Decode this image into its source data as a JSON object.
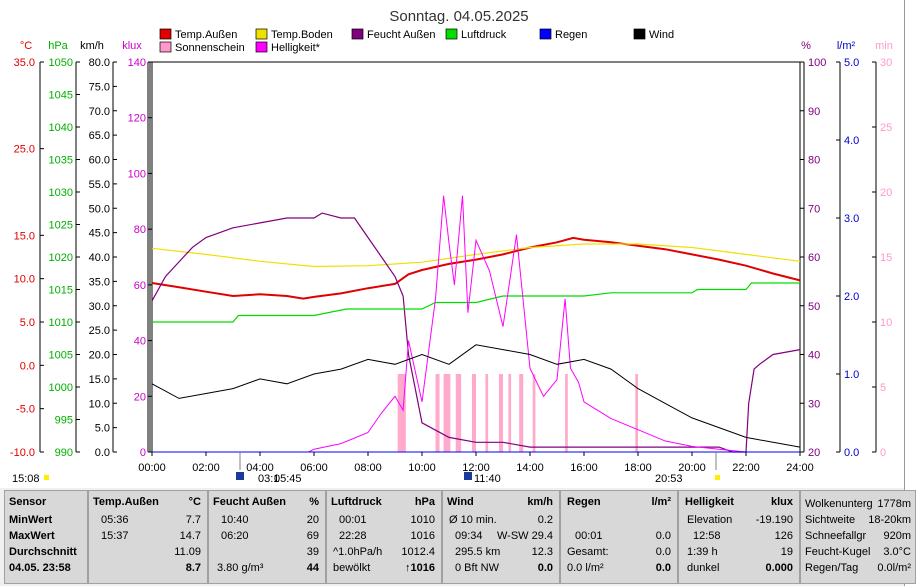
{
  "chart_data": {
    "type": "line",
    "title": "Sonntag. 04.05.2025",
    "x_ticks": [
      "00:00",
      "02:00",
      "04:00",
      "06:00",
      "08:00",
      "10:00",
      "12:00",
      "14:00",
      "16:00",
      "18:00",
      "20:00",
      "22:00",
      "24:00"
    ],
    "xlim": [
      0,
      24
    ],
    "axes": {
      "temp": {
        "unit": "°C",
        "range": [
          -10,
          35
        ],
        "ticks": [
          "35.0",
          "25.0",
          "15.0",
          "10.0",
          "5.0",
          "0.0",
          "-5.0",
          "-10.0"
        ],
        "color": "#e00000"
      },
      "pressure": {
        "unit": "hPa",
        "range": [
          990,
          1050
        ],
        "ticks": [
          "1050",
          "1045",
          "1040",
          "1035",
          "1030",
          "1025",
          "1020",
          "1015",
          "1010",
          "1005",
          "1000",
          "995",
          "990"
        ],
        "color": "#00b000"
      },
      "wind": {
        "unit": "km/h",
        "range": [
          0,
          80
        ],
        "ticks": [
          "80.0",
          "75.0",
          "70.0",
          "65.0",
          "60.0",
          "55.0",
          "50.0",
          "45.0",
          "40.0",
          "35.0",
          "30.0",
          "25.0",
          "20.0",
          "15.0",
          "10.0",
          "5.0",
          "0.0"
        ],
        "color": "#000000"
      },
      "light": {
        "unit": "klux",
        "range": [
          0,
          140
        ],
        "ticks": [
          "140",
          "120",
          "100",
          "80",
          "60",
          "40",
          "20",
          "0"
        ],
        "color": "#cc00cc"
      },
      "humidity": {
        "unit": "%",
        "range": [
          20,
          100
        ],
        "ticks": [
          "100",
          "90",
          "80",
          "70",
          "60",
          "50",
          "40",
          "30",
          "20"
        ],
        "color": "#800080"
      },
      "rain": {
        "unit": "l/m²",
        "range": [
          0,
          5
        ],
        "ticks": [
          "5.0",
          "4.0",
          "3.0",
          "2.0",
          "1.0",
          "0.0"
        ],
        "color": "#0000cc"
      },
      "sunshine": {
        "unit": "min",
        "range": [
          0,
          30
        ],
        "ticks": [
          "30",
          "25",
          "20",
          "15",
          "10",
          "5",
          "0"
        ],
        "color": "#ff99cc"
      }
    },
    "legend": [
      {
        "label": "Temp.Außen",
        "color": "#e00000"
      },
      {
        "label": "Temp.Boden",
        "color": "#f0e000"
      },
      {
        "label": "Feucht Außen",
        "color": "#800080"
      },
      {
        "label": "Luftdruck",
        "color": "#00dd00"
      },
      {
        "label": "Regen",
        "color": "#0000ff"
      },
      {
        "label": "Wind",
        "color": "#000000"
      },
      {
        "label": "Sonnenschein",
        "color": "#ff99cc"
      },
      {
        "label": "Helligkeit*",
        "color": "#ff00ff"
      }
    ],
    "series": [
      {
        "name": "Temp.Außen",
        "axis": "temp",
        "x": [
          0,
          1,
          2,
          3,
          4,
          5,
          5.6,
          6,
          7,
          8,
          9,
          9.5,
          10,
          11,
          12,
          13,
          14,
          15,
          15.6,
          16,
          17,
          18,
          19,
          20,
          21,
          22,
          23,
          24
        ],
        "y": [
          9.5,
          9.0,
          8.5,
          8.0,
          8.2,
          8.0,
          7.7,
          7.9,
          8.3,
          8.9,
          9.4,
          10.5,
          11.0,
          11.7,
          12.2,
          12.8,
          13.6,
          14.2,
          14.7,
          14.5,
          14.2,
          13.8,
          13.4,
          12.8,
          12.2,
          11.5,
          10.6,
          9.8
        ]
      },
      {
        "name": "Temp.Boden",
        "axis": "temp",
        "x": [
          0,
          2,
          4,
          6,
          8,
          10,
          12,
          14,
          16,
          18,
          20,
          22,
          24
        ],
        "y": [
          13.5,
          12.8,
          12.0,
          11.4,
          11.5,
          11.9,
          12.8,
          13.6,
          14.0,
          14.0,
          13.6,
          12.8,
          12.0
        ]
      },
      {
        "name": "Feucht Außen",
        "axis": "humidity",
        "x": [
          0,
          0.5,
          1,
          1.5,
          2,
          3,
          4,
          5,
          5.6,
          6,
          6.3,
          7,
          7.5,
          8,
          8.5,
          9,
          9.3,
          9.5,
          10,
          11,
          12,
          13,
          14,
          15,
          16,
          17,
          18,
          19,
          20,
          21,
          21.5,
          22,
          22.1,
          22.3,
          22.5,
          23,
          24
        ],
        "y": [
          51,
          56,
          59,
          62,
          64,
          66,
          67,
          68,
          68,
          68,
          69,
          68,
          68,
          64,
          60,
          56,
          52,
          40,
          26,
          23,
          22,
          22,
          21,
          21,
          21,
          21,
          21,
          21,
          21,
          21,
          20,
          20,
          30,
          37,
          38,
          40,
          41
        ]
      },
      {
        "name": "Luftdruck",
        "axis": "pressure",
        "x": [
          0,
          3,
          3.2,
          6,
          7.2,
          10,
          10.5,
          12,
          13,
          16,
          17,
          20,
          20.2,
          22,
          22.2,
          24
        ],
        "y": [
          1010,
          1010,
          1011,
          1011,
          1012,
          1012,
          1013,
          1013,
          1014,
          1014,
          1014.5,
          1014.5,
          1015,
          1015,
          1016,
          1016
        ]
      },
      {
        "name": "Helligkeit*",
        "axis": "light",
        "x": [
          0,
          5,
          5.8,
          6,
          7,
          8,
          8.5,
          9,
          9.3,
          9.5,
          10,
          10.5,
          10.8,
          11,
          11.2,
          11.5,
          11.7,
          12,
          12.5,
          13,
          13.5,
          14,
          14.5,
          15,
          15.3,
          15.5,
          15.8,
          16,
          17,
          18,
          19,
          20,
          21,
          22,
          24
        ],
        "y": [
          0,
          0,
          0,
          1,
          3,
          7,
          14,
          20,
          15,
          40,
          18,
          55,
          92,
          75,
          60,
          92,
          50,
          76,
          65,
          45,
          78,
          30,
          20,
          26,
          55,
          30,
          25,
          18,
          12,
          8,
          4,
          2,
          1,
          0,
          0
        ]
      },
      {
        "name": "Wind",
        "axis": "wind",
        "x": [
          0,
          1,
          2,
          3,
          4,
          5,
          6,
          7,
          8,
          9,
          10,
          11,
          12,
          13,
          14,
          15,
          16,
          17,
          18,
          19,
          20,
          21,
          22,
          23,
          24
        ],
        "y": [
          14,
          11,
          12,
          13,
          15,
          14,
          16,
          17,
          19,
          18,
          20,
          18,
          22,
          21,
          20,
          18,
          19,
          17,
          13,
          10,
          7,
          5,
          3,
          2,
          1
        ]
      },
      {
        "name": "Regen",
        "axis": "rain",
        "x": [
          0,
          24
        ],
        "y": [
          0,
          0
        ]
      }
    ],
    "sunshine_bars": [
      {
        "start": 9.1,
        "end": 9.4
      },
      {
        "start": 10.5,
        "end": 10.65
      },
      {
        "start": 10.8,
        "end": 11.05
      },
      {
        "start": 11.25,
        "end": 11.45
      },
      {
        "start": 11.85,
        "end": 12.0
      },
      {
        "start": 12.35,
        "end": 12.45
      },
      {
        "start": 12.85,
        "end": 13.0
      },
      {
        "start": 13.2,
        "end": 13.3
      },
      {
        "start": 13.6,
        "end": 13.75
      },
      {
        "start": 14.1,
        "end": 14.2
      },
      {
        "start": 15.3,
        "end": 15.4
      },
      {
        "start": 17.9,
        "end": 18.0
      }
    ],
    "sunshine_level": 6,
    "markers": [
      {
        "label": "15:08",
        "anchor": "left"
      },
      {
        "label": "03:1",
        "anchor": "right-of-icon"
      },
      {
        "label": "05:45",
        "anchor": "after"
      },
      {
        "label": "11:40",
        "anchor": "right-of-icon"
      },
      {
        "label": "20:53",
        "anchor": "left-of-icon"
      }
    ]
  },
  "table": {
    "labels": {
      "header": "Sensor",
      "min": "MinWert",
      "max": "MaxWert",
      "avg": "Durchschnitt",
      "date": "04.05. 23:58"
    },
    "temp": {
      "header": "Temp.Außen",
      "unit": "°C",
      "min_time": "05:36",
      "min_val": "7.7",
      "max_time": "15:37",
      "max_val": "14.7",
      "avg": "11.09",
      "cur": "8.7"
    },
    "hum": {
      "header": "Feucht Außen",
      "unit": "%",
      "min_time": "10:40",
      "min_val": "20",
      "max_time": "06:20",
      "max_val": "69",
      "avg": "39",
      "cur_label": "3.80 g/m³",
      "cur": "44"
    },
    "press": {
      "header": "Luftdruck",
      "unit": "hPa",
      "min_time": "00:01",
      "min_val": "1010",
      "max_time": "22:28",
      "max_val": "1016",
      "trend_label": "^1.0hPa/h",
      "trend_val": "1012.4",
      "cur_label": "bewölkt",
      "cur": "↑1016"
    },
    "wind": {
      "header": "Wind",
      "unit": "km/h",
      "r1_label": "Ø 10 min.",
      "r1_val": "0.2",
      "r2_time": "09:34",
      "r2_label": "W-SW 29.4",
      "r3_label": "295.5 km",
      "r3_val": "12.3",
      "r4_label": "0 Bft NW",
      "r4_val": "0.0"
    },
    "rain": {
      "header": "Regen",
      "unit": "l/m²",
      "r2_time": "00:01",
      "r2_val": "0.0",
      "r3_label": "Gesamt:",
      "r3_val": "0.0",
      "r4_label": "0.0 l/m²",
      "r4_val": "0.0"
    },
    "light": {
      "header": "Helligkeit",
      "unit": "klux",
      "r1_label": "Elevation",
      "r1_val": "-19.190",
      "r2_time": "12:58",
      "r2_val": "126",
      "r3_label": "1:39 h",
      "r3_val": "19",
      "r4_label": "dunkel",
      "r4_val": "0.000"
    },
    "extra": [
      {
        "label": "Wolkenunterg",
        "value": "1778m"
      },
      {
        "label": "Sichtweite",
        "value": "18-20km"
      },
      {
        "label": "Schneefallgr",
        "value": "920m"
      },
      {
        "label": "Feucht-Kugel",
        "value": "3.0°C"
      },
      {
        "label": "Regen/Tag",
        "value": "0.0l/m²"
      }
    ]
  }
}
